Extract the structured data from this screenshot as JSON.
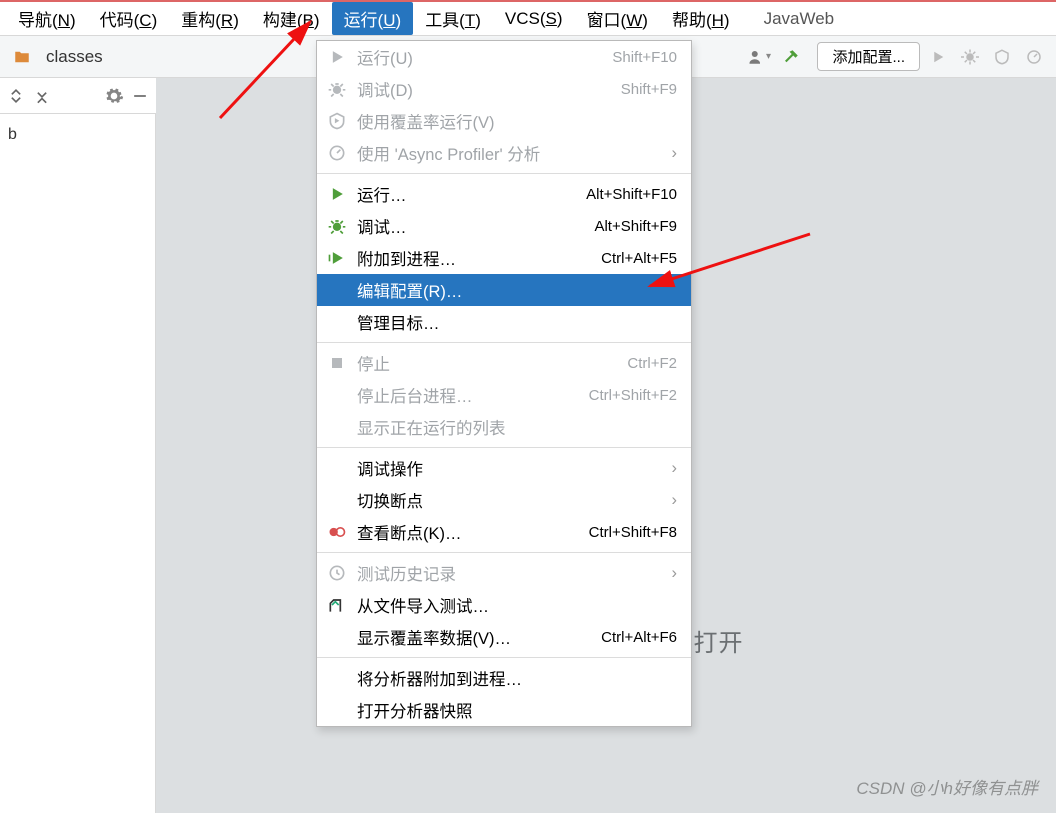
{
  "menubar": {
    "items": [
      {
        "label": "导航(",
        "mn": "N",
        "tail": ")"
      },
      {
        "label": "代码(",
        "mn": "C",
        "tail": ")"
      },
      {
        "label": "重构(",
        "mn": "R",
        "tail": ")"
      },
      {
        "label": "构建(",
        "mn": "B",
        "tail": ")"
      },
      {
        "label": "运行(",
        "mn": "U",
        "tail": ")",
        "active": true
      },
      {
        "label": "工具(",
        "mn": "T",
        "tail": ")"
      },
      {
        "label": "VCS(",
        "mn": "S",
        "tail": ")"
      },
      {
        "label": "窗口(",
        "mn": "W",
        "tail": ")"
      },
      {
        "label": "帮助(",
        "mn": "H",
        "tail": ")"
      }
    ],
    "project": "JavaWeb"
  },
  "toolbar": {
    "breadcrumb": "classes",
    "config_btn": "添加配置..."
  },
  "sidebar": {
    "tree_item": "b"
  },
  "editor": {
    "dropzone": "将文件拖放到此处以打开"
  },
  "dropdown": {
    "groups": [
      [
        {
          "icon": "play",
          "label_pre": "运行(",
          "mn": "U",
          "label_post": ")",
          "shortcut": "Shift+F10",
          "disabled": true
        },
        {
          "icon": "bug",
          "label_pre": "调试(",
          "mn": "D",
          "label_post": ")",
          "shortcut": "Shift+F9",
          "disabled": true
        },
        {
          "icon": "cover",
          "label_pre": "使用覆盖率运行(",
          "mn": "V",
          "label_post": ")",
          "disabled": true
        },
        {
          "icon": "prof",
          "label": "使用 'Async Profiler' 分析",
          "submenu": true,
          "disabled": true
        }
      ],
      [
        {
          "icon": "play-green",
          "label": "运行…",
          "shortcut": "Alt+Shift+F10"
        },
        {
          "icon": "bug-green",
          "label": "调试…",
          "shortcut": "Alt+Shift+F9"
        },
        {
          "icon": "attach",
          "label": "附加到进程…",
          "shortcut": "Ctrl+Alt+F5"
        },
        {
          "label_pre": "编辑配置(",
          "mn": "R",
          "label_post": ")…",
          "selected": true
        },
        {
          "label": "管理目标…"
        }
      ],
      [
        {
          "icon": "stop",
          "label": "停止",
          "shortcut": "Ctrl+F2",
          "disabled": true
        },
        {
          "label": "停止后台进程…",
          "shortcut": "Ctrl+Shift+F2",
          "disabled": true
        },
        {
          "label": "显示正在运行的列表",
          "disabled": true
        }
      ],
      [
        {
          "label": "调试操作",
          "submenu": true
        },
        {
          "label": "切换断点",
          "submenu": true
        },
        {
          "icon": "bp",
          "label_pre": "查看断点(",
          "mn": "K",
          "label_post": ")…",
          "shortcut": "Ctrl+Shift+F8"
        }
      ],
      [
        {
          "icon": "history",
          "label": "测试历史记录",
          "submenu": true,
          "disabled": true
        },
        {
          "icon": "import",
          "label": "从文件导入测试…"
        },
        {
          "label_pre": "显示覆盖率数据(",
          "mn": "V",
          "label_post": ")…",
          "shortcut": "Ctrl+Alt+F6"
        }
      ],
      [
        {
          "label": "将分析器附加到进程…"
        },
        {
          "label": "打开分析器快照"
        }
      ]
    ]
  },
  "watermark": "CSDN @小h好像有点胖"
}
